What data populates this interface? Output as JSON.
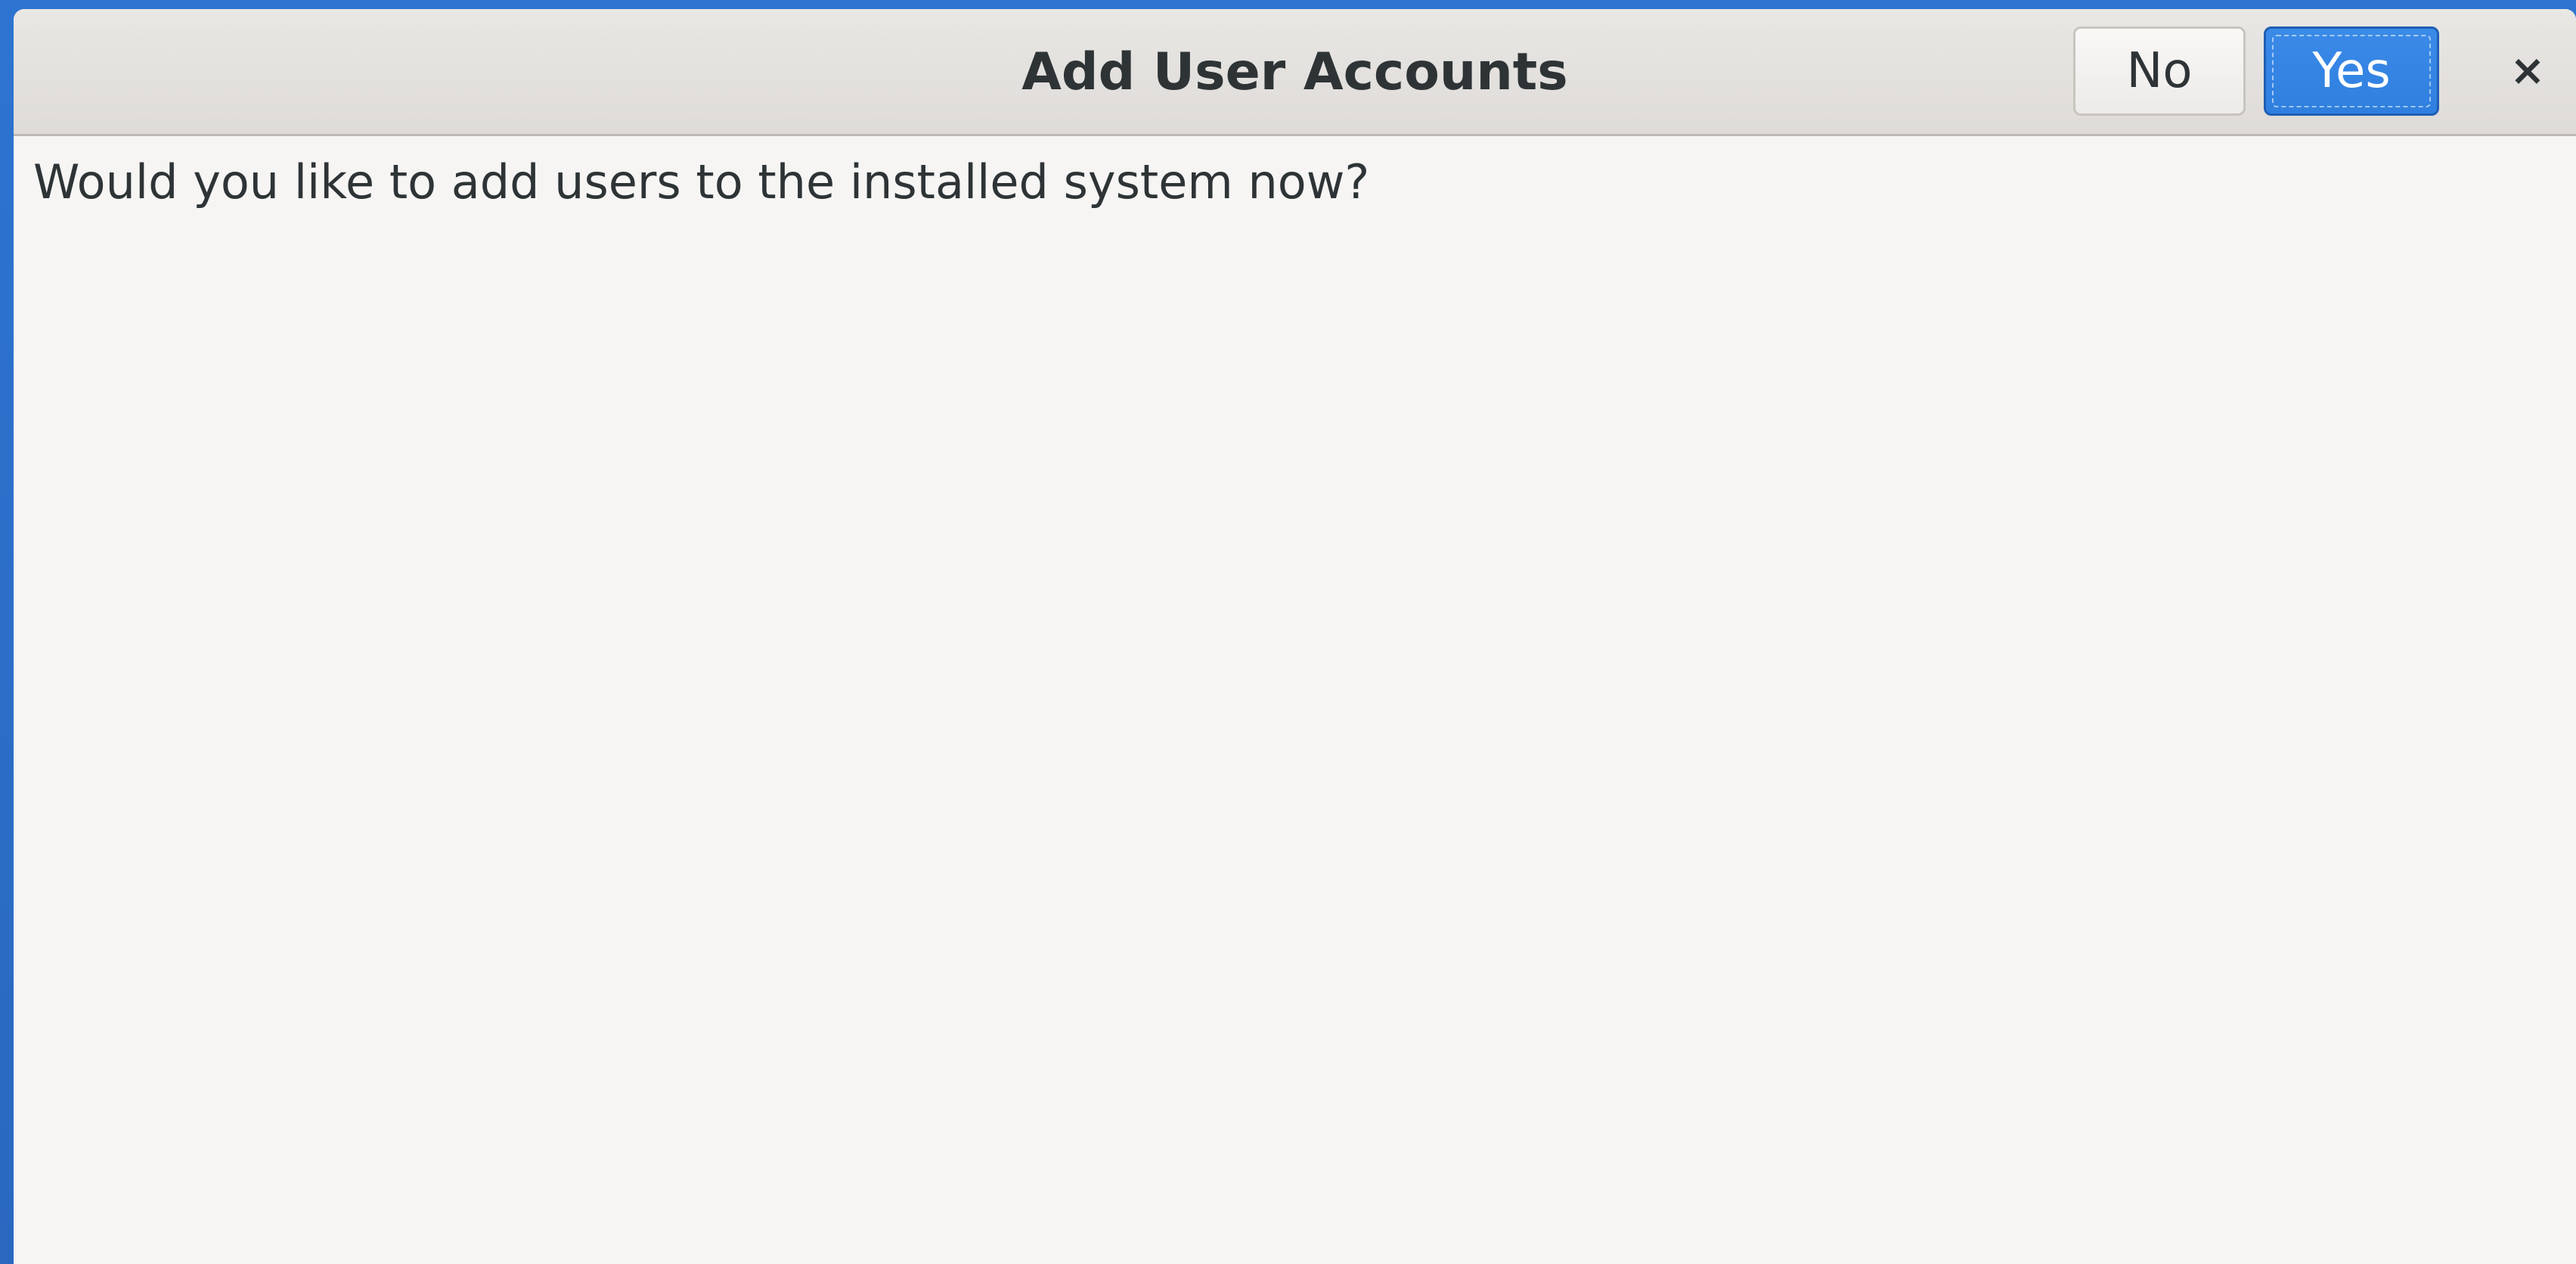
{
  "dialog": {
    "title": "Add User Accounts",
    "no_label": "No",
    "yes_label": "Yes",
    "close_glyph": "×",
    "message": "Would you like to add users to the installed system now?"
  },
  "icons": {
    "close": "close-icon"
  },
  "colors": {
    "desktop_background": "#2a6fc9",
    "dialog_background": "#f6f5f4",
    "headerbar_background": "#dedbd8",
    "primary_button": "#2f7fe0",
    "text": "#2e3436"
  }
}
